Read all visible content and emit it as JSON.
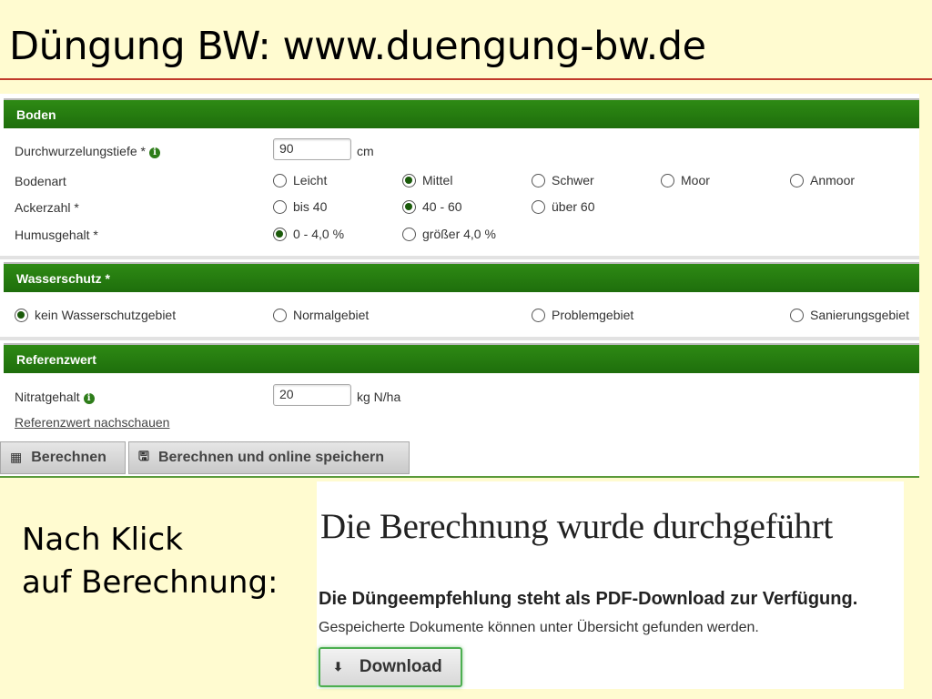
{
  "slide": {
    "title": "Düngung BW: www.duengung-bw.de",
    "note_line1": "Nach Klick",
    "note_line2": "auf Berechnung:"
  },
  "icons": {
    "info": "info-icon",
    "radio_selected": "radio-selected-icon",
    "radio_unselected": "radio-unselected-icon",
    "calculator": "calculator-icon",
    "save": "floppy-disk-icon",
    "download": "download-arrow-icon"
  },
  "colors": {
    "slide_bg": "#fffbd0",
    "section_header": "#257c10",
    "title_rule": "#c0392b",
    "download_border": "#4caf50"
  },
  "boden": {
    "header": "Boden",
    "durchwurzelung": {
      "label": "Durchwurzelungstiefe *",
      "value": "90",
      "unit": "cm"
    },
    "bodenart": {
      "label": "Bodenart",
      "options": [
        "Leicht",
        "Mittel",
        "Schwer",
        "Moor",
        "Anmoor"
      ],
      "selected": "Mittel"
    },
    "ackerzahl": {
      "label": "Ackerzahl *",
      "options": [
        "bis 40",
        "40 - 60",
        "über 60"
      ],
      "selected": "40 - 60"
    },
    "humus": {
      "label": "Humusgehalt *",
      "options": [
        "0 - 4,0 %",
        "größer 4,0 %"
      ],
      "selected": "0 - 4,0 %"
    }
  },
  "wasserschutz": {
    "header": "Wasserschutz *",
    "options": [
      "kein Wasserschutzgebiet",
      "Normalgebiet",
      "Problemgebiet",
      "Sanierungsgebiet"
    ],
    "selected": "kein Wasserschutzgebiet"
  },
  "referenz": {
    "header": "Referenzwert",
    "nitrat": {
      "label": "Nitratgehalt",
      "value": "20",
      "unit": "kg N/ha"
    },
    "link": "Referenzwert nachschauen"
  },
  "buttons": {
    "berechnen": "Berechnen",
    "berechnen_speichern": "Berechnen und online speichern"
  },
  "result": {
    "heading": "Die Berechnung wurde durchgeführt",
    "line1": "Die Düngeempfehlung steht als PDF-Download zur Verfügung.",
    "line2": "Gespeicherte Dokumente können unter Übersicht gefunden werden.",
    "download": "Download"
  }
}
